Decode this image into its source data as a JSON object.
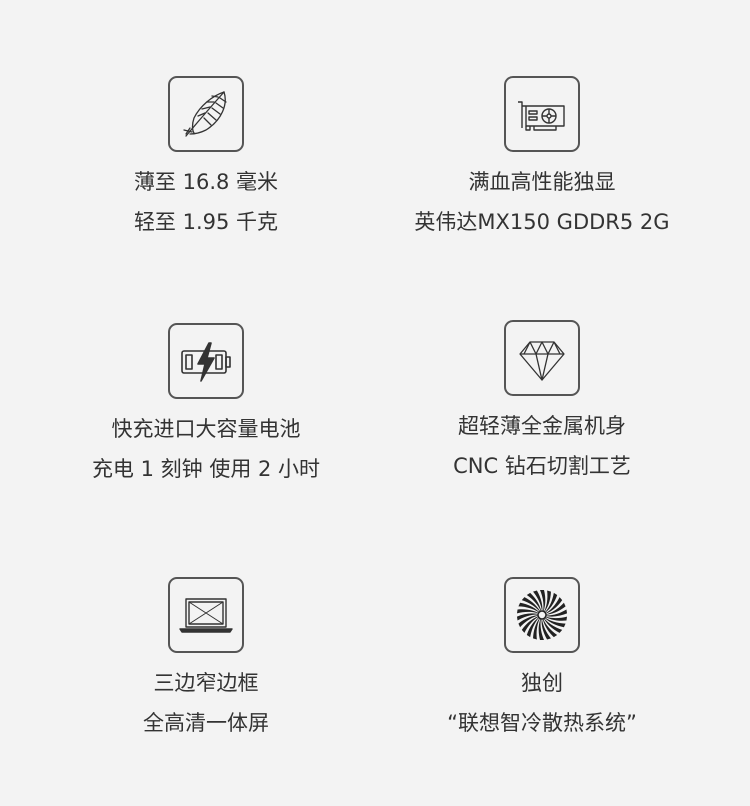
{
  "features": [
    {
      "icon": "feather-icon",
      "line1": "薄至 16.8 毫米",
      "line2": "轻至 1.95 千克"
    },
    {
      "icon": "graphics-card-icon",
      "line1": "满血高性能独显",
      "line2": "英伟达MX150 GDDR5 2G"
    },
    {
      "icon": "fast-charge-battery-icon",
      "line1": "快充进口大容量电池",
      "line2": "充电 1 刻钟 使用 2 小时"
    },
    {
      "icon": "diamond-icon",
      "line1": "超轻薄全金属机身",
      "line2": "CNC 钻石切割工艺"
    },
    {
      "icon": "narrow-bezel-laptop-icon",
      "line1": "三边窄边框",
      "line2": "全高清一体屏"
    },
    {
      "icon": "cooling-fan-icon",
      "line1": "独创",
      "line2": "“联想智冷散热系统”"
    }
  ]
}
